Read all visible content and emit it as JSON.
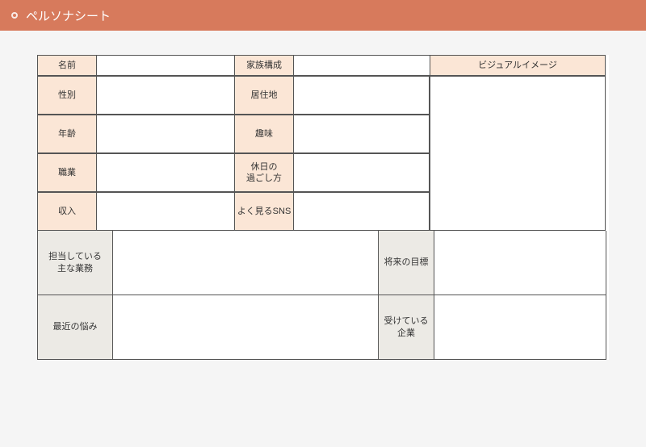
{
  "header": {
    "title": "ペルソナシート"
  },
  "upper": {
    "rows": [
      {
        "left_label": "名前",
        "left_value": "",
        "right_label": "家族構成",
        "right_value": ""
      },
      {
        "left_label": "性別",
        "left_value": "",
        "right_label": "居住地",
        "right_value": ""
      },
      {
        "left_label": "年齢",
        "left_value": "",
        "right_label": "趣味",
        "right_value": ""
      },
      {
        "left_label": "職業",
        "left_value": "",
        "right_label": "休日の\n過ごし方",
        "right_value": ""
      },
      {
        "left_label": "収入",
        "left_value": "",
        "right_label": "よく見るSNS",
        "right_value": ""
      }
    ],
    "visual_label": "ビジュアルイメージ",
    "visual_value": ""
  },
  "lower": {
    "rows": [
      {
        "left_label": "担当している\n主な業務",
        "left_value": "",
        "right_label": "将来の目標",
        "right_value": ""
      },
      {
        "left_label": "最近の悩み",
        "left_value": "",
        "right_label": "受けている\n企業",
        "right_value": ""
      }
    ]
  }
}
